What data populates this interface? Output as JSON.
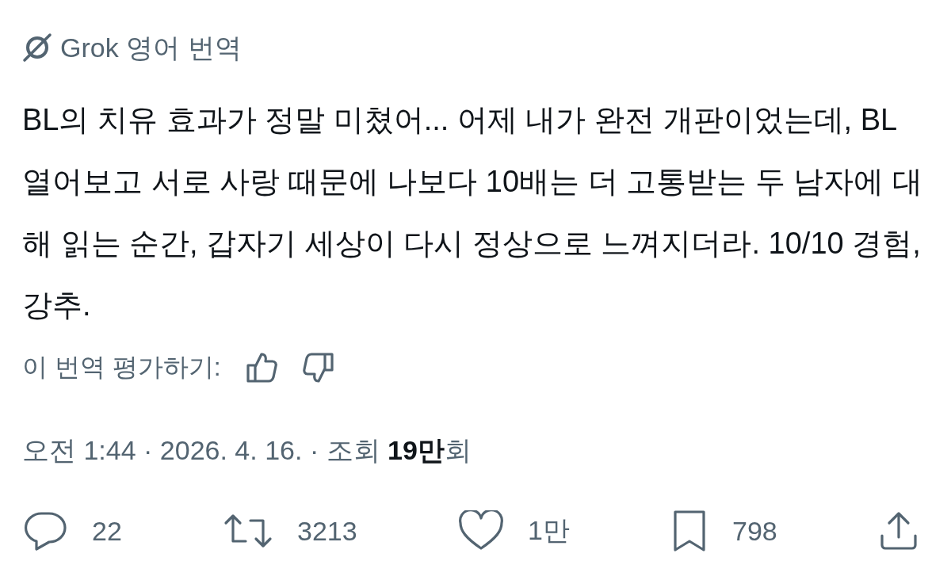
{
  "translation_header": {
    "label": "Grok 영어 번역"
  },
  "post_text": "BL의 치유 효과가 정말 미쳤어... 어제 내가 완전 개판이었는데, BL 열어보고 서로 사랑 때문에 나보다 10배는 더 고통받는 두 남자에 대해 읽는 순간, 갑자기 세상이 다시 정상으로 느껴지더라. 10/10 경험, 강추.",
  "rating": {
    "label": "이 번역 평가하기:"
  },
  "meta": "오전 1:44 · 2026. 4. 16. · 조회 **19만**회",
  "actions": [
    {
      "kind": "reply",
      "count": "22"
    },
    {
      "kind": "repost",
      "count": "3213"
    },
    {
      "kind": "like",
      "count": "1만"
    },
    {
      "kind": "bookmark",
      "count": "798"
    },
    {
      "kind": "share"
    }
  ]
}
